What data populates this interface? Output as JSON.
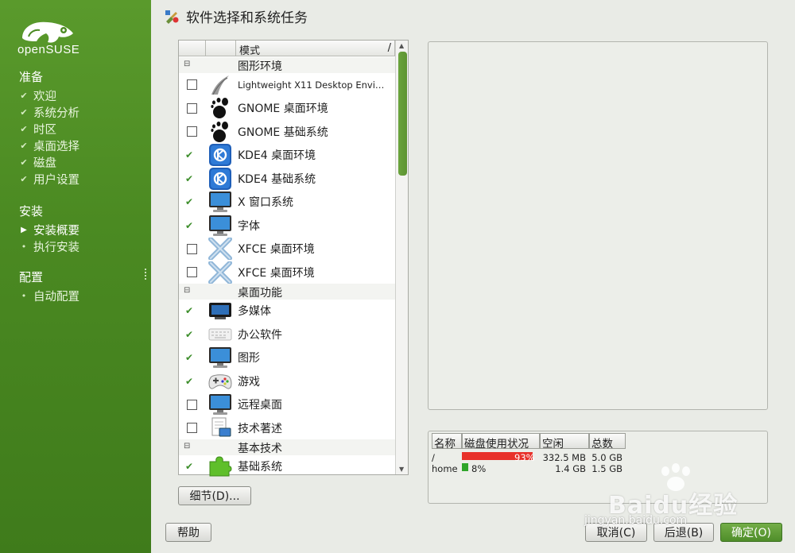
{
  "sidebar": {
    "brand": "openSUSE",
    "sections": [
      {
        "title": "准备",
        "items": [
          {
            "label": "欢迎",
            "state": "done"
          },
          {
            "label": "系统分析",
            "state": "done"
          },
          {
            "label": "时区",
            "state": "done"
          },
          {
            "label": "桌面选择",
            "state": "done"
          },
          {
            "label": "磁盘",
            "state": "done"
          },
          {
            "label": "用户设置",
            "state": "done"
          }
        ]
      },
      {
        "title": "安装",
        "items": [
          {
            "label": "安装概要",
            "state": "current"
          },
          {
            "label": "执行安装",
            "state": "pending"
          }
        ]
      },
      {
        "title": "配置",
        "items": [
          {
            "label": "自动配置",
            "state": "pending"
          }
        ]
      }
    ],
    "marks": {
      "done": "✔",
      "current": "▶",
      "pending": "•"
    }
  },
  "window": {
    "title": "软件选择和系统任务"
  },
  "list": {
    "header": {
      "col3": "模式",
      "sort": "/"
    },
    "rows": [
      {
        "type": "group",
        "label": "图形环境"
      },
      {
        "type": "item",
        "label": "Lightweight X11 Desktop Envi…",
        "checked": false,
        "icon": "lxde-icon",
        "small": true
      },
      {
        "type": "item",
        "label": "GNOME 桌面环境",
        "checked": false,
        "icon": "gnome-icon"
      },
      {
        "type": "item",
        "label": "GNOME 基础系统",
        "checked": false,
        "icon": "gnome-icon"
      },
      {
        "type": "item",
        "label": "KDE4 桌面环境",
        "checked": true,
        "icon": "kde-icon"
      },
      {
        "type": "item",
        "label": "KDE4 基础系统",
        "checked": true,
        "icon": "kde-icon"
      },
      {
        "type": "item",
        "label": "X 窗口系统",
        "checked": true,
        "icon": "monitor-icon"
      },
      {
        "type": "item",
        "label": "字体",
        "checked": true,
        "icon": "monitor-icon"
      },
      {
        "type": "item",
        "label": "XFCE 桌面环境",
        "checked": false,
        "icon": "xfce-icon"
      },
      {
        "type": "item",
        "label": "XFCE 桌面环境",
        "checked": false,
        "icon": "xfce-icon"
      },
      {
        "type": "group",
        "label": "桌面功能"
      },
      {
        "type": "item",
        "label": "多媒体",
        "checked": true,
        "icon": "tv-icon"
      },
      {
        "type": "item",
        "label": "办公软件",
        "checked": true,
        "icon": "keyboard-icon"
      },
      {
        "type": "item",
        "label": "图形",
        "checked": true,
        "icon": "monitor-icon"
      },
      {
        "type": "item",
        "label": "游戏",
        "checked": true,
        "icon": "gamepad-icon"
      },
      {
        "type": "item",
        "label": "远程桌面",
        "checked": false,
        "icon": "monitor-icon"
      },
      {
        "type": "item",
        "label": "技术著述",
        "checked": false,
        "icon": "document-icon"
      },
      {
        "type": "group",
        "label": "基本技术"
      },
      {
        "type": "item",
        "label": "基础系统",
        "checked": true,
        "icon": "puzzle-icon"
      }
    ],
    "check_mark": "✔"
  },
  "buttons": {
    "details": "细节(D)...",
    "help": "帮助",
    "cancel": "取消(C)",
    "back": "后退(B)",
    "ok": "确定(O)"
  },
  "disk": {
    "headers": [
      "名称",
      "磁盘使用状况",
      "空闲",
      "总数"
    ],
    "rows": [
      {
        "name": "/",
        "usage_pct": "93%",
        "usage": 0.93,
        "free": "332.5 MB",
        "total": "5.0 GB",
        "color": "#e8312a"
      },
      {
        "name": "home",
        "usage_pct": "8%",
        "usage": 0.08,
        "free": "1.4 GB",
        "total": "1.5 GB",
        "color": "#2fa52a"
      }
    ]
  },
  "watermark": {
    "logo": "Baidu经验",
    "url": "jingyan.baidu.com"
  },
  "colors": {
    "accent": "#5a9a2c",
    "ok_button": "#4f8e2a"
  }
}
